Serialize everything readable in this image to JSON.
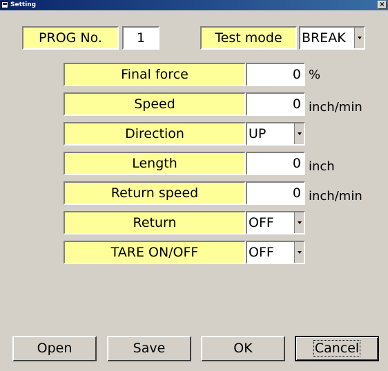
{
  "window": {
    "title": "Setting",
    "close_glyph": "×"
  },
  "header": {
    "prog_label": "PROG No.",
    "prog_value": "1",
    "test_mode_label": "Test mode",
    "test_mode_value": "BREAK"
  },
  "params": [
    {
      "label": "Final force",
      "value": "0",
      "unit": "%"
    },
    {
      "label": "Speed",
      "value": "0",
      "unit": "inch/min"
    },
    {
      "label": "Direction",
      "value": "UP",
      "unit": ""
    },
    {
      "label": "Length",
      "value": "0",
      "unit": "inch"
    },
    {
      "label": "Return speed",
      "value": "0",
      "unit": "inch/min"
    },
    {
      "label": "Return",
      "value": "OFF",
      "unit": ""
    },
    {
      "label": "TARE ON/OFF",
      "value": "OFF",
      "unit": ""
    }
  ],
  "buttons": {
    "open": "Open",
    "save": "Save",
    "ok": "OK",
    "cancel": "Cancel"
  },
  "colors": {
    "label_bg": "#ffff99",
    "window_bg": "#d4d0c8",
    "title_bar": "#0a246a"
  },
  "icons": {
    "window_icon": "app-window-icon",
    "combo_arrow": "chevron-down-icon"
  }
}
